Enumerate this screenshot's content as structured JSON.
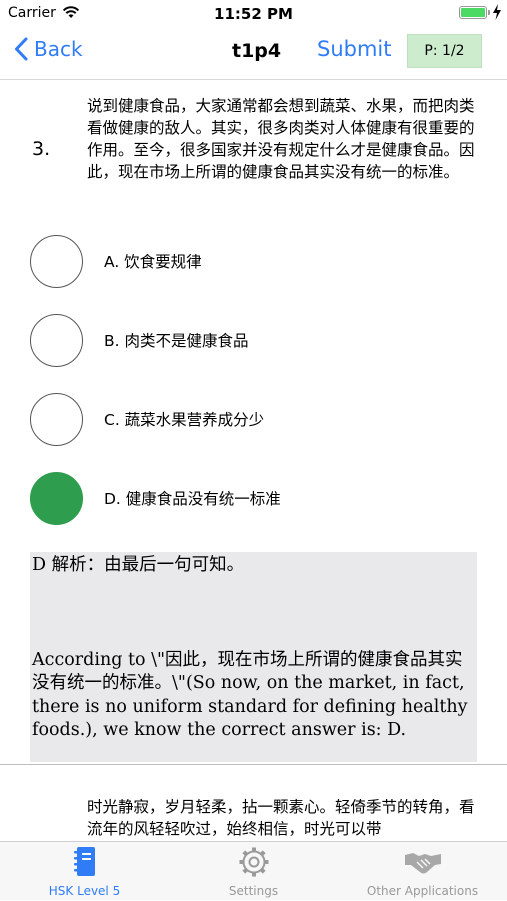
{
  "status_bar": {
    "carrier": "Carrier",
    "time": "11:52 PM"
  },
  "nav": {
    "back_label": "Back",
    "title": "t1p4",
    "submit_label": "Submit",
    "page_indicator": "P: 1/2"
  },
  "question": {
    "number": "3.",
    "text": "说到健康食品，大家通常都会想到蔬菜、水果，而把肉类看做健康的敌人。其实，很多肉类对人体健康有很重要的作用。至今，很多国家并没有规定什么才是健康食品。因此，现在市场上所谓的健康食品其实没有统一的标准。",
    "options": [
      {
        "label": "A. 饮食要规律",
        "selected": false
      },
      {
        "label": "B. 肉类不是健康食品",
        "selected": false
      },
      {
        "label": "C. 蔬菜水果营养成分少",
        "selected": false
      },
      {
        "label": "D. 健康食品没有统一标准",
        "selected": true
      }
    ]
  },
  "explanation": {
    "head": "D 解析：由最后一句可知。",
    "body": "According to \\\"因此，现在市场上所谓的健康食品其实没有统一的标准。\\\"(So now, on the market, in fact, there is no uniform standard for defining healthy foods.), we know the correct answer is: D."
  },
  "next_passage": {
    "text": "时光静寂，岁月轻柔，拈一颗素心。轻倚季节的转角，看流年的风轻轻吹过，始终相信，时光可以带"
  },
  "tabs": [
    {
      "label": "HSK Level 5",
      "icon": "notebook-icon",
      "active": true
    },
    {
      "label": "Settings",
      "icon": "gear-icon",
      "active": false
    },
    {
      "label": "Other Applications",
      "icon": "handshake-icon",
      "active": false
    }
  ],
  "colors": {
    "accent": "#2f7cf6",
    "selected": "#2e9e4e",
    "badge": "#cdeccd",
    "panel": "#e9e9ec"
  }
}
